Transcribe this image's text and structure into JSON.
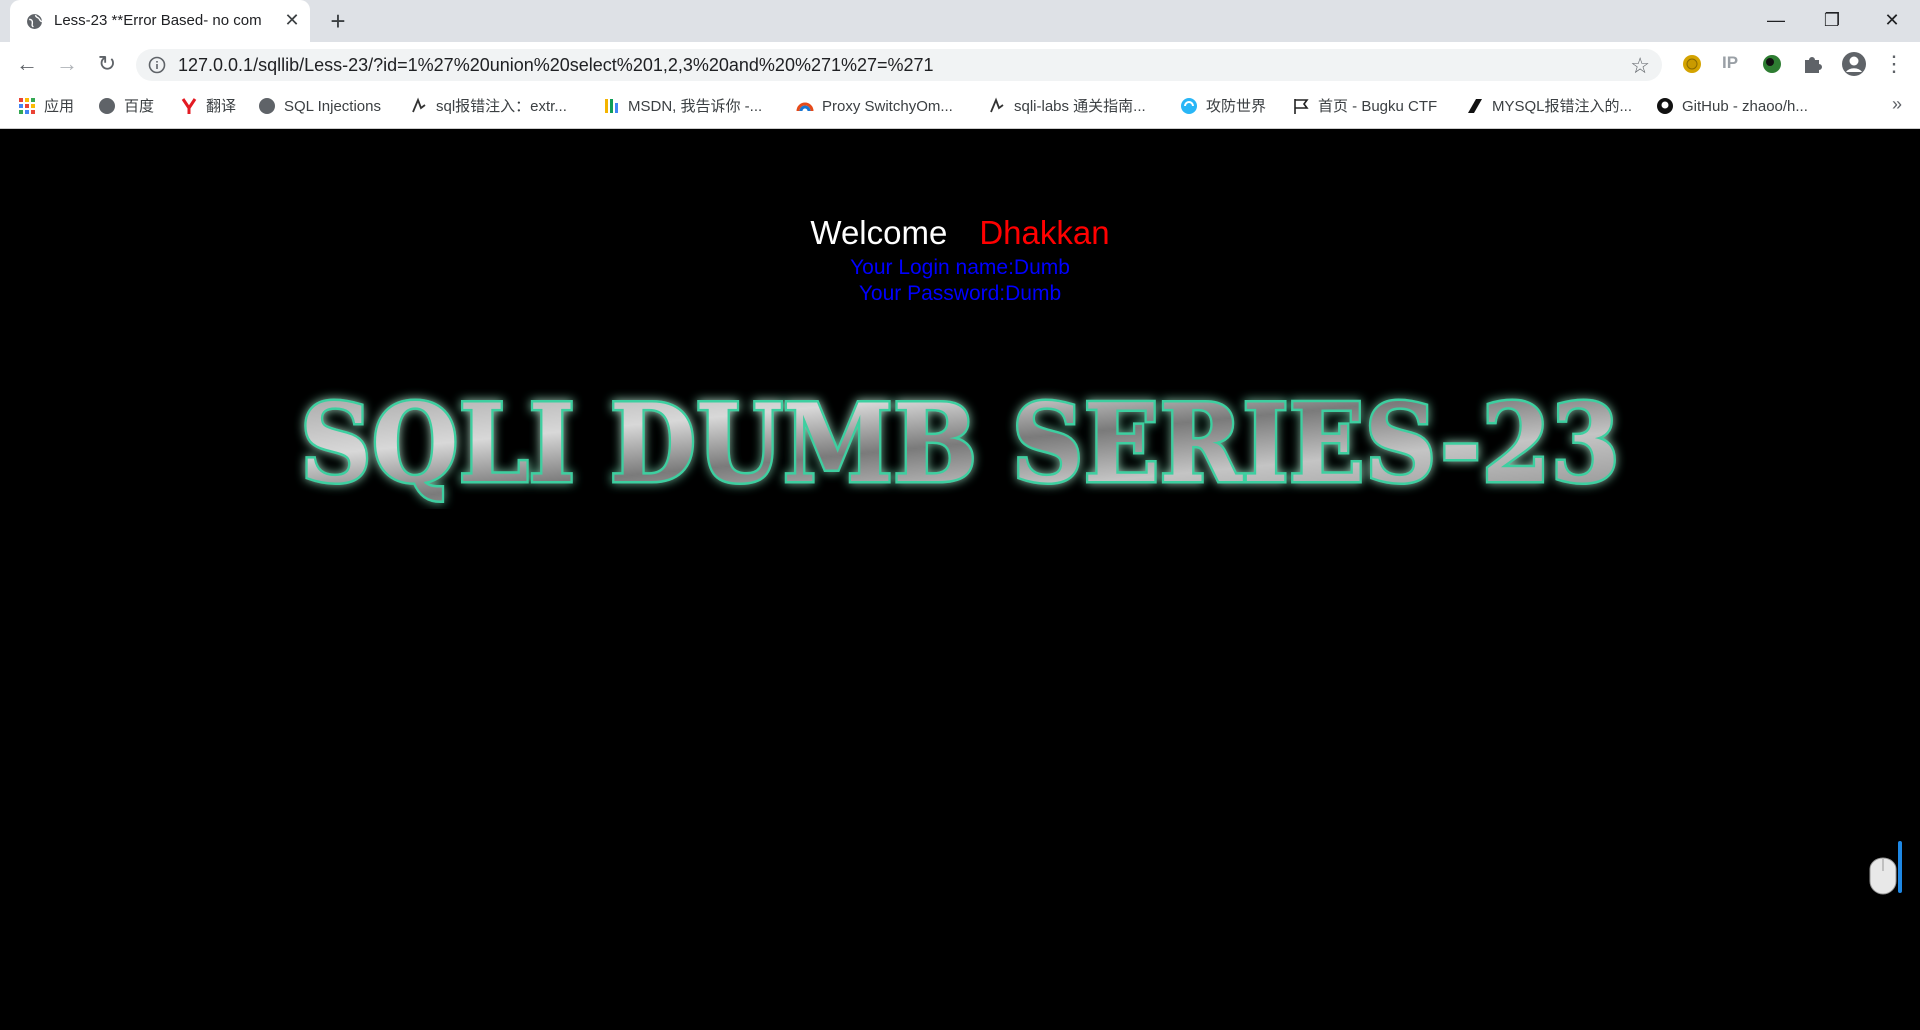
{
  "tab": {
    "title": "Less-23 **Error Based- no com",
    "close": "✕"
  },
  "newtab": "+",
  "window": {
    "minimize": "—",
    "maximize": "❐",
    "close": "✕"
  },
  "nav": {
    "back": "←",
    "forward": "→",
    "reload": "↻"
  },
  "address": {
    "url": "127.0.0.1/sqllib/Less-23/?id=1%27%20union%20select%201,2,3%20and%20%271%27=%271",
    "star": "☆"
  },
  "extensions": {
    "ip_label": "IP",
    "menu": "⋮"
  },
  "bookmarks": [
    {
      "label": "应用",
      "icon": "apps-grid-icon"
    },
    {
      "label": "百度",
      "icon": "globe-icon"
    },
    {
      "label": "翻译",
      "icon": "youdao-icon"
    },
    {
      "label": "SQL Injections",
      "icon": "globe-icon"
    },
    {
      "label": "sql报错注入：extr...",
      "icon": "sqli-icon"
    },
    {
      "label": "MSDN, 我告诉你 -...",
      "icon": "msdn-icon"
    },
    {
      "label": "Proxy SwitchyOm...",
      "icon": "switchy-icon"
    },
    {
      "label": "sqli-labs 通关指南...",
      "icon": "sqli-icon"
    },
    {
      "label": "攻防世界",
      "icon": "adworld-icon"
    },
    {
      "label": "首页 - Bugku CTF",
      "icon": "flag-icon"
    },
    {
      "label": "MYSQL报错注入的...",
      "icon": "zhihu-icon"
    },
    {
      "label": "GitHub - zhaoo/h...",
      "icon": "github-icon"
    }
  ],
  "bookmarks_more": "»",
  "page": {
    "welcome": "Welcome",
    "name": "Dhakkan",
    "login_line": "Your Login name:Dumb",
    "password_line": "Your Password:Dumb",
    "banner_text": "SQLI DUMB SERIES-23"
  },
  "colors": {
    "welcome": "#ffffff",
    "name": "#ff0000",
    "info": "#0000ff",
    "background": "#000000",
    "banner_glow": "#3ccfa0"
  }
}
